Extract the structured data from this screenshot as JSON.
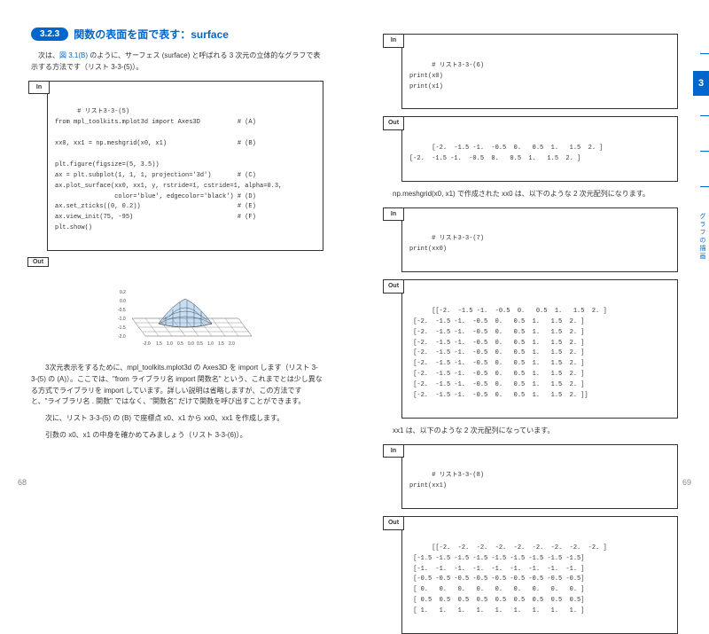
{
  "section": {
    "num": "3.2.3",
    "title": "関数の表面を面で表す：surface"
  },
  "left": {
    "p1_a": "　次は、",
    "p1_link": "図 3.1(B)",
    "p1_b": " のように、サーフェス (surface) と呼ばれる 3 次元の立体的なグラフで表示する方法です（リスト 3-3-(5)）。",
    "in_label": "In",
    "code1": "# リスト3-3-(5)\nfrom mpl_toolkits.mplot3d import Axes3D          # (A)\n\nxx0, xx1 = np.meshgrid(x0, x1)                   # (B)\n\nplt.figure(figsize=(5, 3.5))\nax = plt.subplot(1, 1, 1, projection='3d')       # (C)\nax.plot_surface(xx0, xx1, y, rstride=1, cstride=1, alpha=0.3,\n                color='blue', edgecolor='black') # (D)\nax.set_zticks((0, 0.2))                          # (E)\nax.view_init(75, -95)                            # (F)\nplt.show()",
    "out_label": "Out",
    "p2": "　3次元表示をするために、mpl_toolkits.mplot3d の Axes3D を import します（リスト 3-3-(5) の (A)）。ここでは、\"from ライブラリ名 import 関数名\" という、これまでとは少し異なる方式でライブラリを import しています。詳しい説明は省略しますが、この方法ですと、\"ライブラリ名 . 関数\" ではなく、\"関数名\" だけで関数を呼び出すことができます。",
    "p3": "　次に、リスト 3-3-(5) の (B) で座標点 x0、x1 から xx0、xx1 を作成します。",
    "p4": "　引数の x0、x1 の中身を確かめてみましょう（リスト 3-3-(6)）。",
    "pagenum": "68"
  },
  "right": {
    "in_label": "In",
    "out_label": "Out",
    "code6": "# リスト3-3-(6)\nprint(x0)\nprint(x1)",
    "out6": "[-2.  -1.5 -1.  -0.5  0.   0.5  1.   1.5  2. ]\n[-2.  -1.5 -1.  -0.5  0.   0.5  1.   1.5  2. ]",
    "p5": "　np.meshgrid(x0, x1) で作成された xx0 は、以下のような 2 次元配列になります。",
    "code7": "# リスト3-3-(7)\nprint(xx0)",
    "out7": "[[-2.  -1.5 -1.  -0.5  0.   0.5  1.   1.5  2. ]\n [-2.  -1.5 -1.  -0.5  0.   0.5  1.   1.5  2. ]\n [-2.  -1.5 -1.  -0.5  0.   0.5  1.   1.5  2. ]\n [-2.  -1.5 -1.  -0.5  0.   0.5  1.   1.5  2. ]\n [-2.  -1.5 -1.  -0.5  0.   0.5  1.   1.5  2. ]\n [-2.  -1.5 -1.  -0.5  0.   0.5  1.   1.5  2. ]\n [-2.  -1.5 -1.  -0.5  0.   0.5  1.   1.5  2. ]\n [-2.  -1.5 -1.  -0.5  0.   0.5  1.   1.5  2. ]\n [-2.  -1.5 -1.  -0.5  0.   0.5  1.   1.5  2. ]]",
    "p6": "　xx1 は、以下のような 2 次元配列になっています。",
    "code8": "# リスト3-3-(8)\nprint(xx1)",
    "out8": "[[-2.  -2.  -2.  -2.  -2.  -2.  -2.  -2.  -2. ]\n [-1.5 -1.5 -1.5 -1.5 -1.5 -1.5 -1.5 -1.5 -1.5]\n [-1.  -1.  -1.  -1.  -1.  -1.  -1.  -1.  -1. ]\n [-0.5 -0.5 -0.5 -0.5 -0.5 -0.5 -0.5 -0.5 -0.5]\n [ 0.   0.   0.   0.   0.   0.   0.   0.   0. ]\n [ 0.5  0.5  0.5  0.5  0.5  0.5  0.5  0.5  0.5]\n [ 1.   1.   1.   1.   1.   1.   1.   1.   1. ]",
    "tab": "3",
    "side": "グラフの描画",
    "pagenum": "69"
  },
  "chart_data": {
    "type": "surface",
    "title": "",
    "x_range": [
      -2,
      2
    ],
    "y_range": [
      -2,
      2
    ],
    "z_ticks": [
      0,
      0.2
    ],
    "x_ticks": [
      -2,
      -1.5,
      -1,
      -0.5,
      0,
      0.5,
      1,
      1.5,
      2
    ],
    "y_ticks": [
      -2,
      -1.5,
      -1,
      -0.5,
      0,
      0.5,
      1,
      1.5,
      2
    ],
    "z_tick_labels": [
      "0.2",
      "0.0",
      "-0.5",
      "-1.0",
      "-1.5",
      "-2.0"
    ],
    "color": "blue",
    "edgecolor": "black",
    "alpha": 0.3,
    "view": {
      "elev": 75,
      "azim": -95
    },
    "function": "2D Gaussian-like bump centered near origin, peak ≈ 0.2, floor ≈ 0"
  }
}
